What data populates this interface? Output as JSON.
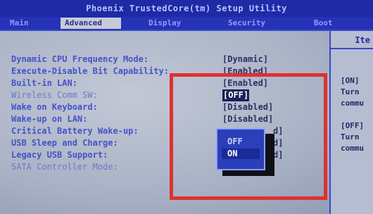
{
  "title": "Phoenix TrustedCore(tm) Setup Utility",
  "tabs": [
    {
      "label": "Main",
      "active": false
    },
    {
      "label": "Advanced",
      "active": true
    },
    {
      "label": "Display",
      "active": false
    },
    {
      "label": "Security",
      "active": false
    },
    {
      "label": "Boot",
      "active": false
    }
  ],
  "settings": [
    {
      "label": "Dynamic CPU Frequency Mode:",
      "value": "[Dynamic]"
    },
    {
      "label": "Execute-Disable Bit Capability:",
      "value": "[Enabled]"
    },
    {
      "label": "Built-in LAN:",
      "value": "[Enabled]"
    },
    {
      "label": "Wireless Comm SW:",
      "value": "[OFF]"
    },
    {
      "label": "Wake on Keyboard:",
      "value": "[Disabled]"
    },
    {
      "label": "Wake-up on LAN:",
      "value": "[Disabled]"
    },
    {
      "label": "Critical Battery Wake-up:",
      "value": "d]"
    },
    {
      "label": "USB Sleep and Charge:",
      "value": "d]"
    },
    {
      "label": "Legacy USB Support:",
      "value": "d]"
    },
    {
      "label": "SATA Controller Mode:",
      "value": ""
    }
  ],
  "help": {
    "header": "Ite",
    "lines": [
      "[ON]",
      "Turn",
      "commu",
      "[OFF]",
      "Turn",
      "commu"
    ]
  },
  "popup": {
    "options": [
      "OFF",
      "ON"
    ],
    "selected": "ON"
  },
  "colors": {
    "highlight_box": "#e03030",
    "bios_blue": "#2433b8"
  }
}
